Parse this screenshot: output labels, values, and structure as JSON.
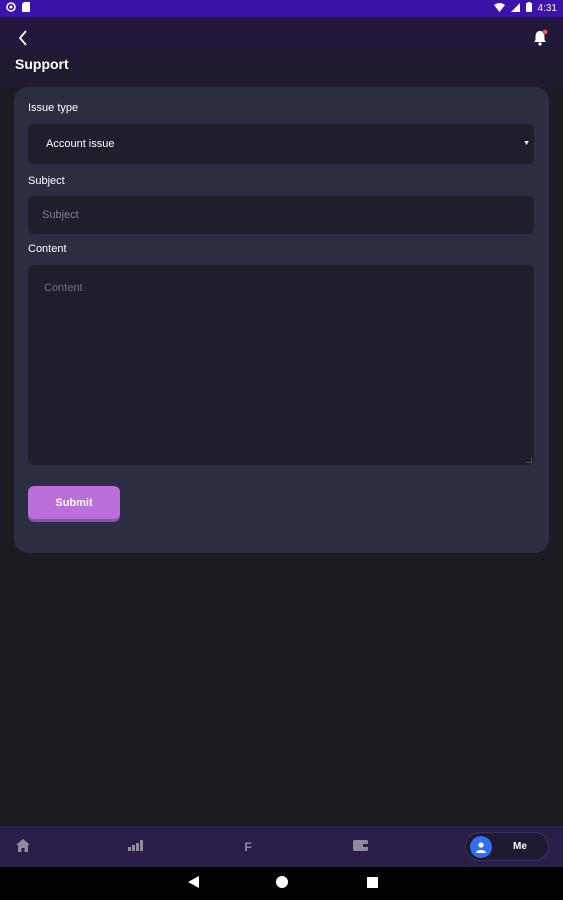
{
  "status_bar": {
    "time": "4:31",
    "icons": [
      "settings-icon",
      "sim-icon",
      "wifi-icon",
      "signal-icon",
      "battery-icon"
    ]
  },
  "header": {
    "title": "Support",
    "back_icon": "chevron-left-icon",
    "bell_icon": "bell-icon",
    "bell_badge_color": "#ff4d4d"
  },
  "form": {
    "issue_type_label": "Issue type",
    "issue_type_value": "Account issue",
    "subject_label": "Subject",
    "subject_placeholder": "Subject",
    "content_label": "Content",
    "content_placeholder": "Content",
    "submit_label": "Submit"
  },
  "bottom_nav": {
    "items": [
      {
        "icon": "home-icon",
        "label": ""
      },
      {
        "icon": "bar-chart-icon",
        "label": ""
      },
      {
        "icon": "f-icon",
        "label": "F"
      },
      {
        "icon": "wallet-icon",
        "label": ""
      },
      {
        "icon": "user-icon",
        "label": "Me",
        "active": true
      }
    ]
  },
  "colors": {
    "accent": "#bb6fd9",
    "status_bar": "#3a13a8",
    "card": "#2b2d40",
    "input": "#1f1f2b",
    "avatar": "#2f6ff2"
  }
}
